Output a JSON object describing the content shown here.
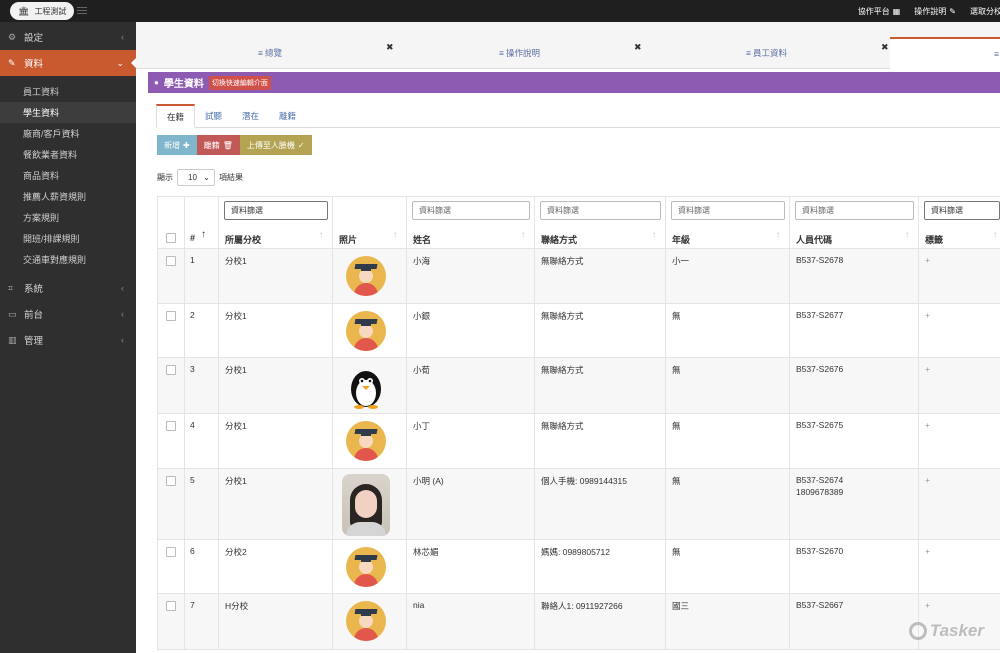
{
  "topbar": {
    "brand": "工程測試",
    "nav": [
      {
        "label": "協作平台",
        "icon": "grid-icon"
      },
      {
        "label": "操作說明",
        "icon": "link-icon"
      },
      {
        "label": "選取分校",
        "icon": ""
      }
    ]
  },
  "sidebar": {
    "groups": [
      {
        "label": "設定",
        "icon": "gear-icon"
      },
      {
        "label": "資料",
        "icon": "edit-icon",
        "active": true,
        "items": [
          "員工資料",
          "學生資料",
          "廠商/客戶資料",
          "餐飲業者資料",
          "商品資料",
          "推薦人薪資規則",
          "方案規則",
          "開班/排課規則",
          "交通車對應規則"
        ]
      },
      {
        "label": "系統",
        "icon": "tag-icon"
      },
      {
        "label": "前台",
        "icon": "monitor-icon"
      },
      {
        "label": "管理",
        "icon": "chart-icon"
      }
    ]
  },
  "tabs": [
    {
      "label": "總覽"
    },
    {
      "label": "操作說明"
    },
    {
      "label": "員工資料"
    }
  ],
  "panel": {
    "title": "學生資料",
    "badge": "切換快速編輯介面"
  },
  "subtabs": [
    "在籍",
    "試聽",
    "潛在",
    "離籍"
  ],
  "buttons": {
    "add": "新增",
    "leave": "離籍",
    "upload": "上傳至人臉機"
  },
  "show": {
    "prefix": "顯示",
    "value": "10",
    "suffix": "項結果"
  },
  "table": {
    "filter_placeholder": "資料篩選",
    "headers": {
      "num": "#",
      "branch": "所屬分校",
      "photo": "照片",
      "name": "姓名",
      "contact": "聯絡方式",
      "grade": "年級",
      "code": "人員代碼",
      "tag": "標籤"
    },
    "rows": [
      {
        "num": "1",
        "branch": "分校1",
        "avatar": "graduate",
        "name": "小海",
        "contact": "無聯絡方式",
        "grade": "小一",
        "code": "B537-S2678",
        "code2": "",
        "tag": "+"
      },
      {
        "num": "2",
        "branch": "分校1",
        "avatar": "graduate",
        "name": "小銀",
        "contact": "無聯絡方式",
        "grade": "無",
        "code": "B537-S2677",
        "code2": "",
        "tag": "+"
      },
      {
        "num": "3",
        "branch": "分校1",
        "avatar": "penguin",
        "name": "小荀",
        "contact": "無聯絡方式",
        "grade": "無",
        "code": "B537-S2676",
        "code2": "",
        "tag": "+"
      },
      {
        "num": "4",
        "branch": "分校1",
        "avatar": "graduate",
        "name": "小丁",
        "contact": "無聯絡方式",
        "grade": "無",
        "code": "B537-S2675",
        "code2": "",
        "tag": "+"
      },
      {
        "num": "5",
        "branch": "分校1",
        "avatar": "photo",
        "name": "小明 (A)",
        "contact": "個人手機: 0989144315",
        "grade": "無",
        "code": "B537-S2674",
        "code2": "1809678389",
        "tag": "+"
      },
      {
        "num": "6",
        "branch": "分校2",
        "avatar": "graduate",
        "name": "林芯媚",
        "contact": "媽媽: 0989805712",
        "grade": "無",
        "code": "B537-S2670",
        "code2": "",
        "tag": "+"
      },
      {
        "num": "7",
        "branch": "H分校",
        "avatar": "graduate",
        "name": "nia",
        "contact": "聯絡人1: 0911927266",
        "grade": "國三",
        "code": "B537-S2667",
        "code2": "",
        "tag": "+"
      }
    ]
  },
  "watermark": "Tasker"
}
